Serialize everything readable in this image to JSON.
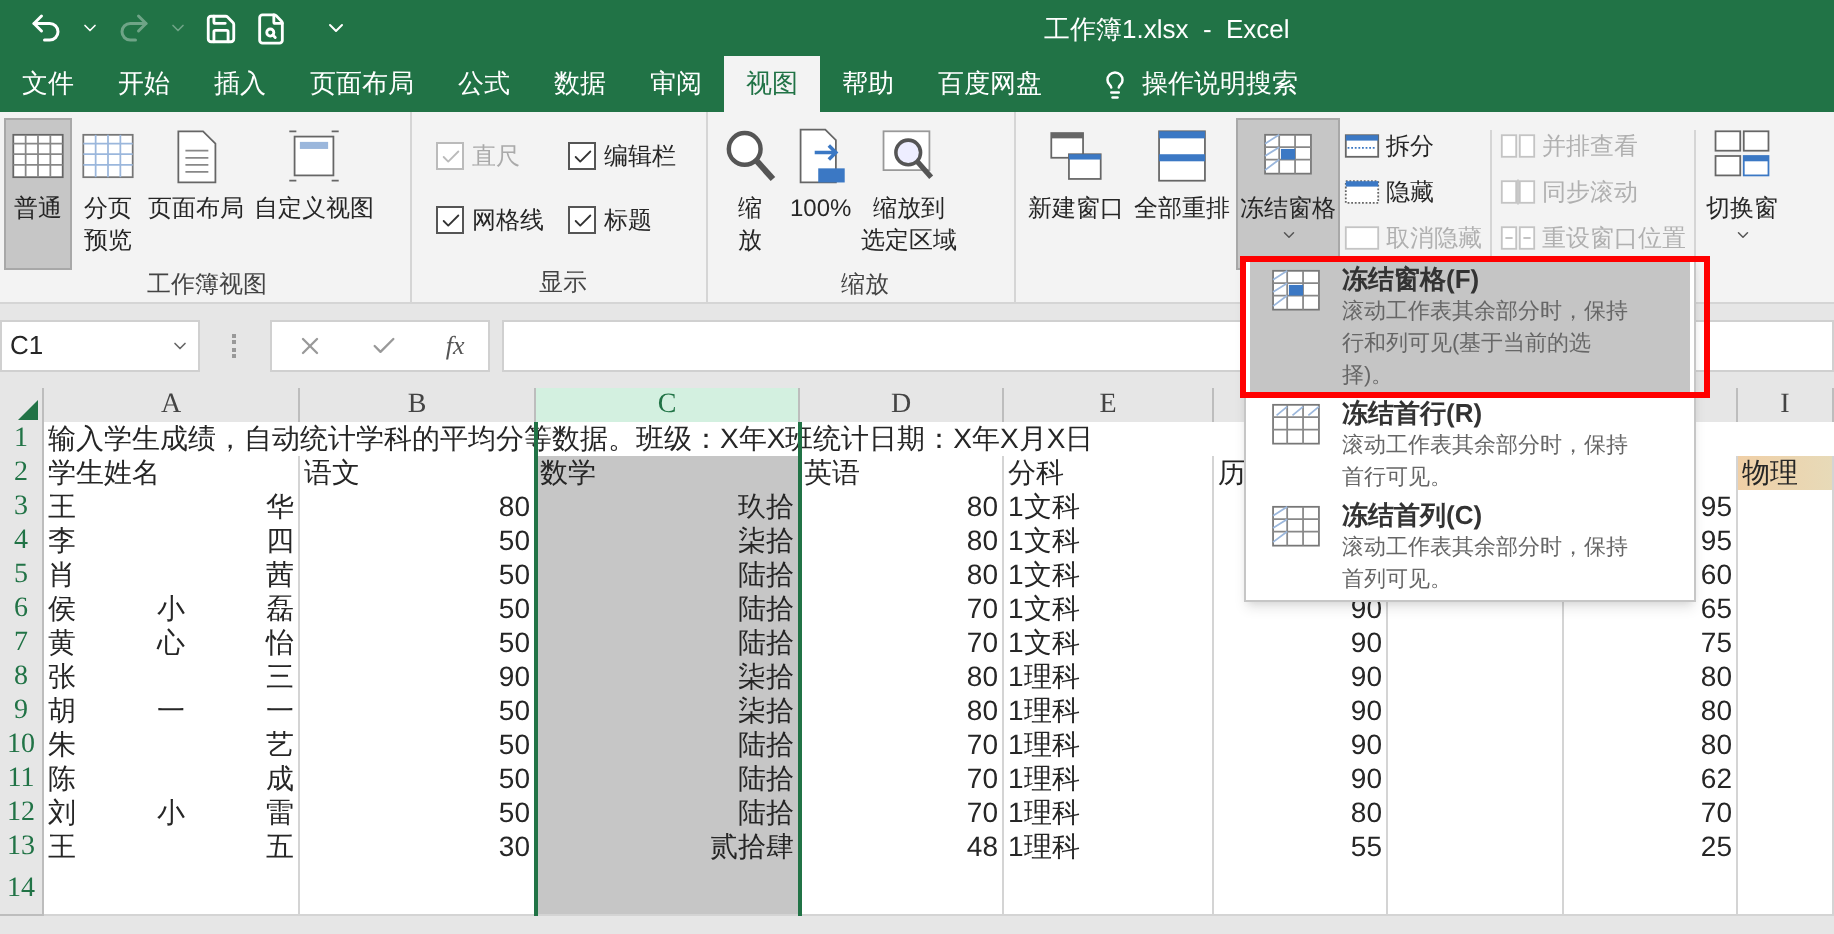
{
  "quick_access": [
    {
      "kind": "undo",
      "disabled": false
    },
    {
      "kind": "redo",
      "disabled": true
    },
    {
      "kind": "save",
      "disabled": false
    },
    {
      "kind": "preview",
      "disabled": false
    }
  ],
  "window": {
    "title": "工作簿1.xlsx  -  Excel"
  },
  "tabs": [
    {
      "label": "文件",
      "selected": false
    },
    {
      "label": "开始",
      "selected": false
    },
    {
      "label": "插入",
      "selected": false
    },
    {
      "label": "页面布局",
      "selected": false
    },
    {
      "label": "公式",
      "selected": false
    },
    {
      "label": "数据",
      "selected": false
    },
    {
      "label": "审阅",
      "selected": false
    },
    {
      "label": "视图",
      "selected": true
    },
    {
      "label": "帮助",
      "selected": false
    },
    {
      "label": "百度网盘",
      "selected": false
    }
  ],
  "tell_me": "操作说明搜索",
  "ribbon": {
    "groups": [
      {
        "label": "工作簿视图",
        "items": [
          {
            "kind": "large",
            "lines": [
              "普通"
            ],
            "selected": true,
            "dropdown": false
          },
          {
            "kind": "large",
            "lines": [
              "分页",
              "预览"
            ],
            "selected": false,
            "dropdown": false
          },
          {
            "kind": "large",
            "lines": [
              "页面布局"
            ],
            "selected": false,
            "dropdown": false
          },
          {
            "kind": "large",
            "lines": [
              "自定义视图"
            ],
            "selected": false,
            "dropdown": false
          }
        ]
      },
      {
        "label": "显示",
        "items": [
          {
            "kind": "checks",
            "checks": [
              {
                "label": "直尺",
                "checked": true,
                "disabled": true
              },
              {
                "label": "编辑栏",
                "checked": true,
                "disabled": false
              },
              {
                "label": "网格线",
                "checked": true,
                "disabled": false
              },
              {
                "label": "标题",
                "checked": true,
                "disabled": false
              }
            ]
          }
        ]
      },
      {
        "label": "缩放",
        "items": [
          {
            "kind": "large",
            "lines": [
              "缩",
              "放"
            ],
            "selected": false,
            "dropdown": false
          },
          {
            "kind": "large",
            "lines": [
              "100%"
            ],
            "selected": false,
            "dropdown": false
          },
          {
            "kind": "large",
            "lines": [
              "缩放到",
              "选定区域"
            ],
            "selected": false,
            "dropdown": false
          }
        ]
      },
      {
        "items": [
          {
            "kind": "large",
            "lines": [
              "新建窗口"
            ],
            "selected": false,
            "dropdown": false
          },
          {
            "kind": "large",
            "lines": [
              "全部重排"
            ],
            "selected": false,
            "dropdown": false
          },
          {
            "kind": "large",
            "lines": [
              "冻结窗格"
            ],
            "selected": true,
            "dropdown": true
          },
          {
            "kind": "small",
            "smalls": [
              {
                "label": "拆分",
                "disabled": false
              },
              {
                "label": "隐藏",
                "disabled": false
              },
              {
                "label": "取消隐藏",
                "disabled": true
              }
            ]
          },
          {
            "kind": "separator"
          },
          {
            "kind": "small",
            "smalls": [
              {
                "label": "并排查看",
                "disabled": true
              },
              {
                "label": "同步滚动",
                "disabled": true
              },
              {
                "label": "重设窗口位置",
                "disabled": true
              }
            ]
          },
          {
            "kind": "separator"
          },
          {
            "kind": "large",
            "lines": [
              "切换窗"
            ],
            "selected": false,
            "dropdown": true
          }
        ]
      }
    ]
  },
  "formula_bar": {
    "name_box": "C1",
    "function_button": "fx"
  },
  "sheet": {
    "columns": {
      "a": {
        "label": "A",
        "selected": false
      },
      "b": {
        "label": "B",
        "selected": false
      },
      "c": {
        "label": "C",
        "selected": true
      },
      "d": {
        "label": "D",
        "selected": false
      },
      "e": {
        "label": "E",
        "selected": false
      },
      "i": {
        "label": "I",
        "selected": false
      }
    },
    "rows": [
      {
        "kind": "title",
        "number": "1",
        "a": "输入学生成绩，自动统计学科的平均分等数据。班级：X年X班统计日期：X年X月X日"
      },
      {
        "kind": "header",
        "number": "2",
        "a": "学生姓名",
        "b": "语文",
        "c": "数学",
        "d": "英语",
        "e": "分科",
        "f": "历",
        "i": "物理",
        "i_highlighted": true
      },
      {
        "kind": "data",
        "number": "3",
        "a": [
          "王",
          "华"
        ],
        "b": "80",
        "c": "玖拾",
        "d": "80",
        "e": "1文科",
        "h": "95"
      },
      {
        "kind": "data",
        "number": "4",
        "a": [
          "李",
          "四"
        ],
        "b": "50",
        "c": "柒拾",
        "d": "80",
        "e": "1文科",
        "h": "95"
      },
      {
        "kind": "data",
        "number": "5",
        "a": [
          "肖",
          "茜"
        ],
        "b": "50",
        "c": "陆拾",
        "d": "80",
        "e": "1文科",
        "h": "60"
      },
      {
        "kind": "data",
        "number": "6",
        "a": [
          "侯",
          "小",
          "磊"
        ],
        "b": "50",
        "c": "陆拾",
        "d": "70",
        "e": "1文科",
        "f": "90",
        "h": "65"
      },
      {
        "kind": "data",
        "number": "7",
        "a": [
          "黄",
          "心",
          "怡"
        ],
        "b": "50",
        "c": "陆拾",
        "d": "70",
        "e": "1文科",
        "f": "90",
        "h": "75"
      },
      {
        "kind": "data",
        "number": "8",
        "a": [
          "张",
          "三"
        ],
        "b": "90",
        "c": "柒拾",
        "d": "80",
        "e": "1理科",
        "f": "90",
        "h": "80"
      },
      {
        "kind": "data",
        "number": "9",
        "a": [
          "胡",
          "一",
          "一"
        ],
        "b": "50",
        "c": "柒拾",
        "d": "80",
        "e": "1理科",
        "f": "90",
        "h": "80"
      },
      {
        "kind": "data",
        "number": "10",
        "a": [
          "朱",
          "艺"
        ],
        "b": "50",
        "c": "陆拾",
        "d": "70",
        "e": "1理科",
        "f": "90",
        "h": "80"
      },
      {
        "kind": "data",
        "number": "11",
        "a": [
          "陈",
          "成"
        ],
        "b": "50",
        "c": "陆拾",
        "d": "70",
        "e": "1理科",
        "f": "90",
        "h": "62"
      },
      {
        "kind": "data",
        "number": "12",
        "a": [
          "刘",
          "小",
          "雷"
        ],
        "b": "50",
        "c": "陆拾",
        "d": "70",
        "e": "1理科",
        "f": "80",
        "h": "70"
      },
      {
        "kind": "data",
        "number": "13",
        "a": [
          "王",
          "五"
        ],
        "b": "30",
        "c": "贰拾肆",
        "d": "48",
        "e": "1理科",
        "f": "55",
        "h": "25"
      },
      {
        "kind": "data",
        "number": "14"
      }
    ]
  },
  "freeze_menu": {
    "items": [
      {
        "title": "冻结窗格(F)",
        "description": "滚动工作表其余部分时，保持行和列可见(基于当前的选择)。",
        "selected": true,
        "annotated": true
      },
      {
        "title": "冻结首行(R)",
        "description": "滚动工作表其余部分时，保持首行可见。",
        "selected": false,
        "annotated": false
      },
      {
        "title": "冻结首列(C)",
        "description": "滚动工作表其余部分时，保持首列可见。",
        "selected": false,
        "annotated": false
      }
    ]
  }
}
